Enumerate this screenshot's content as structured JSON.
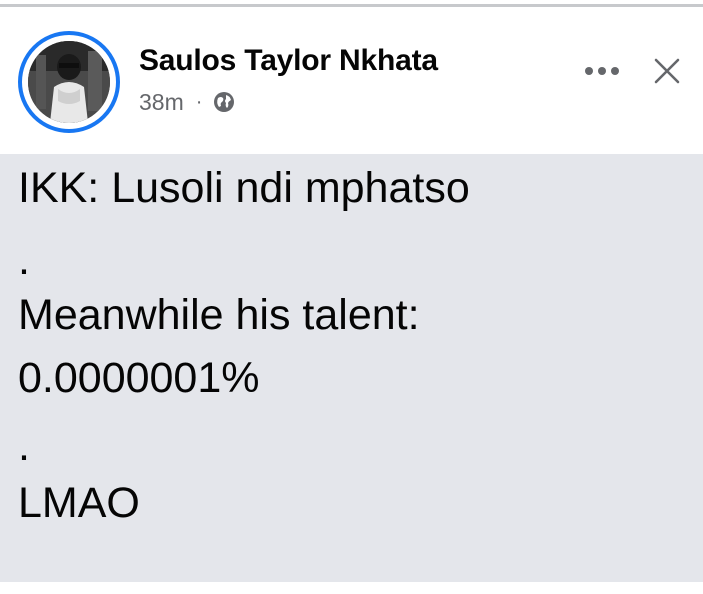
{
  "post": {
    "author_name": "Saulos Taylor Nkhata",
    "timestamp": "38m",
    "separator": "·",
    "privacy_icon": "globe-icon",
    "more_icon": "more-options-icon",
    "close_icon": "close-icon",
    "lines": [
      "IKK: Lusoli ndi mphatso",
      ".",
      "Meanwhile his talent:",
      "0.0000001%",
      ".",
      "LMAO"
    ]
  },
  "colors": {
    "accent": "#1877f2",
    "text_primary": "#050505",
    "text_secondary": "#65676b",
    "post_background": "#e4e6eb"
  }
}
